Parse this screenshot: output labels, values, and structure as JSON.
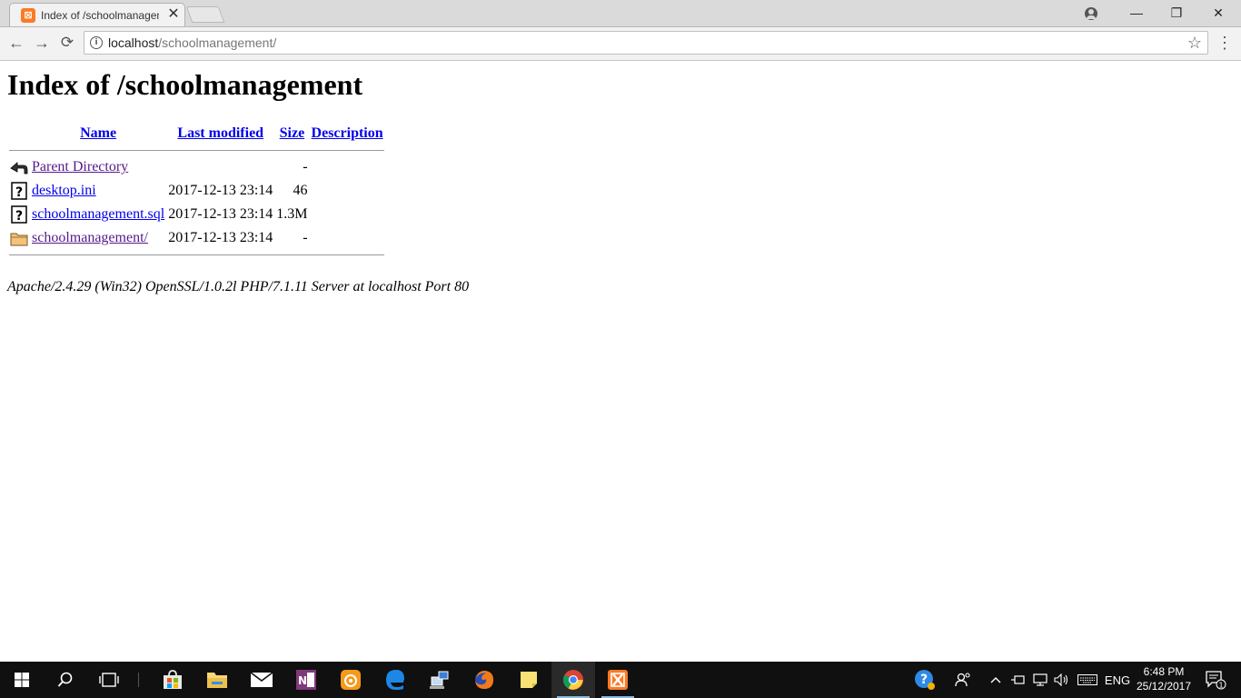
{
  "browser": {
    "tab_title": "Index of /schoolmanagement/",
    "tab_close": "✕",
    "url_host": "localhost",
    "url_path": "/schoolmanagement/",
    "icons": {
      "back": "←",
      "forward": "→",
      "reload": "⟳",
      "star": "☆",
      "menu": "⋮",
      "minimize": "—",
      "restore": "❐",
      "close": "✕",
      "info": "i"
    }
  },
  "page": {
    "title": "Index of /schoolmanagement",
    "columns": {
      "name": "Name",
      "last_modified": "Last modified",
      "size": "Size",
      "description": "Description"
    },
    "rows": [
      {
        "icon": "back-arrow-icon",
        "name": "Parent Directory",
        "modified": "",
        "size": "-",
        "description": "",
        "visited": true
      },
      {
        "icon": "unknown-file-icon",
        "name": "desktop.ini",
        "modified": "2017-12-13 23:14",
        "size": "46",
        "description": "",
        "visited": false
      },
      {
        "icon": "unknown-file-icon",
        "name": "schoolmanagement.sql",
        "modified": "2017-12-13 23:14",
        "size": "1.3M",
        "description": "",
        "visited": false
      },
      {
        "icon": "folder-icon",
        "name": "schoolmanagement/",
        "modified": "2017-12-13 23:14",
        "size": "-",
        "description": "",
        "visited": true
      }
    ],
    "server_signature": "Apache/2.4.29 (Win32) OpenSSL/1.0.2l PHP/7.1.11 Server at localhost Port 80"
  },
  "taskbar": {
    "language": "ENG",
    "time": "6:48 PM",
    "date": "25/12/2017",
    "notification_count": "1",
    "colors": {
      "accent": "#8fb8dc",
      "background": "#101010"
    }
  }
}
